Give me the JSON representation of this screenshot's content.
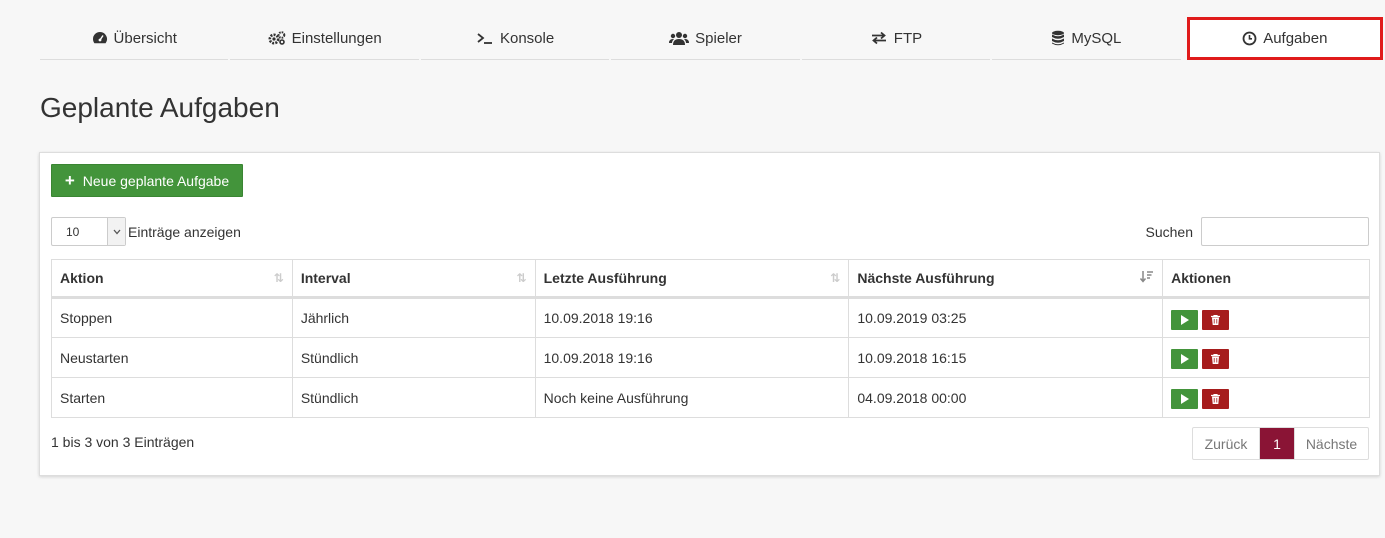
{
  "nav": {
    "items": [
      {
        "label": "Übersicht",
        "icon": "dashboard-icon"
      },
      {
        "label": "Einstellungen",
        "icon": "gears-icon"
      },
      {
        "label": "Konsole",
        "icon": "terminal-icon"
      },
      {
        "label": "Spieler",
        "icon": "users-icon"
      },
      {
        "label": "FTP",
        "icon": "exchange-icon"
      },
      {
        "label": "MySQL",
        "icon": "database-icon"
      },
      {
        "label": "Aufgaben",
        "icon": "clock-icon"
      }
    ],
    "active": "Aufgaben"
  },
  "page": {
    "title": "Geplante Aufgaben"
  },
  "toolbar": {
    "new_label": "Neue geplante Aufgabe"
  },
  "length": {
    "value": "10",
    "label": "Einträge anzeigen"
  },
  "search": {
    "label": "Suchen",
    "value": ""
  },
  "table": {
    "headers": [
      "Aktion",
      "Interval",
      "Letzte Ausführung",
      "Nächste Ausführung",
      "Aktionen"
    ],
    "rows": [
      [
        "Stoppen",
        "Jährlich",
        "10.09.2018 19:16",
        "10.09.2019 03:25"
      ],
      [
        "Neustarten",
        "Stündlich",
        "10.09.2018 19:16",
        "10.09.2018 16:15"
      ],
      [
        "Starten",
        "Stündlich",
        "Noch keine Ausführung",
        "04.09.2018 00:00"
      ]
    ]
  },
  "footer": {
    "info": "1 bis 3 von 3 Einträgen",
    "prev": "Zurück",
    "current": "1",
    "next": "Nächste"
  },
  "colors": {
    "accent_green": "#43943b",
    "danger_red": "#a61c1c",
    "page_active": "#8a1435",
    "highlight": "#e01b1b"
  }
}
